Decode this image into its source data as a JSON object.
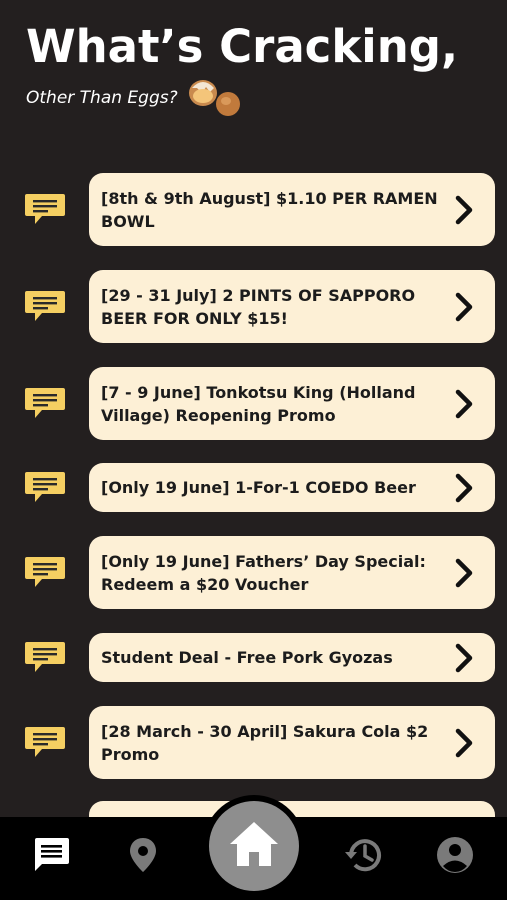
{
  "header": {
    "title": "What’s Cracking,",
    "subtitle": "Other Than Eggs?"
  },
  "promos": [
    {
      "label": "[8th & 9th August] $1.10 PER RAMEN BOWL"
    },
    {
      "label": "[29 - 31 July] 2 PINTS OF SAPPORO BEER FOR ONLY $15!"
    },
    {
      "label": "[7 - 9 June] Tonkotsu King (Holland Village) Reopening Promo"
    },
    {
      "label": "[Only 19 June] 1-For-1 COEDO Beer"
    },
    {
      "label": "[Only 19 June] Fathers’ Day Special: Redeem a $20 Voucher"
    },
    {
      "label": "Student Deal - Free Pork Gyozas"
    },
    {
      "label": "[28 March - 30 April] Sakura Cola $2 Promo"
    }
  ],
  "nav": {
    "items": [
      "chat-icon",
      "location-icon",
      "home-icon",
      "history-icon",
      "profile-icon"
    ],
    "active": "chat-icon"
  },
  "colors": {
    "background": "#231f1f",
    "card": "#fdf0d6",
    "icon_yellow": "#f5cf62",
    "nav_bar": "#000000",
    "home_button": "#8e8e8e"
  }
}
